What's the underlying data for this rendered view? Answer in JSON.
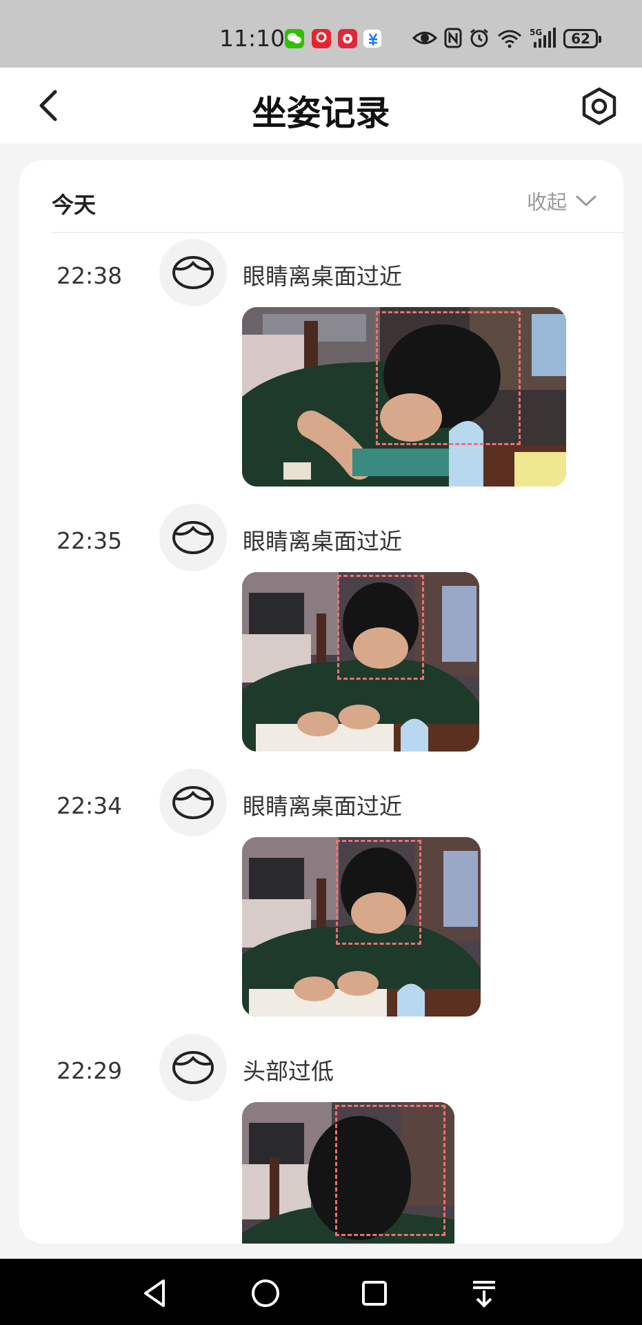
{
  "status_bar": {
    "time": "11:10",
    "battery": "62",
    "notification_icons": [
      "wechat-icon",
      "app-red-icon",
      "app-red2-icon",
      "alipay-icon"
    ],
    "system_icons": [
      "eye-icon",
      "nfc-icon",
      "alarm-icon",
      "wifi-icon",
      "5g-signal-icon"
    ]
  },
  "header": {
    "title": "坐姿记录",
    "back_icon": "chevron-left-icon",
    "settings_icon": "settings-icon"
  },
  "day_section": {
    "label": "今天",
    "collapse_label": "收起",
    "collapse_icon": "chevron-down-icon"
  },
  "records": [
    {
      "time": "22:38",
      "text": "眼睛离桌面过近",
      "avatar_icon": "face-icon"
    },
    {
      "time": "22:35",
      "text": "眼睛离桌面过近",
      "avatar_icon": "face-icon"
    },
    {
      "time": "22:34",
      "text": "眼睛离桌面过近",
      "avatar_icon": "face-icon"
    },
    {
      "time": "22:29",
      "text": "头部过低",
      "avatar_icon": "face-icon"
    }
  ],
  "nav_bar": {
    "icons": [
      "back-triangle-icon",
      "home-circle-icon",
      "recents-square-icon",
      "notification-pull-icon"
    ]
  },
  "colors": {
    "status_bar_bg": "#c8c8c8",
    "detection_box": "#f07070",
    "nav_bar_bg": "#000000"
  }
}
